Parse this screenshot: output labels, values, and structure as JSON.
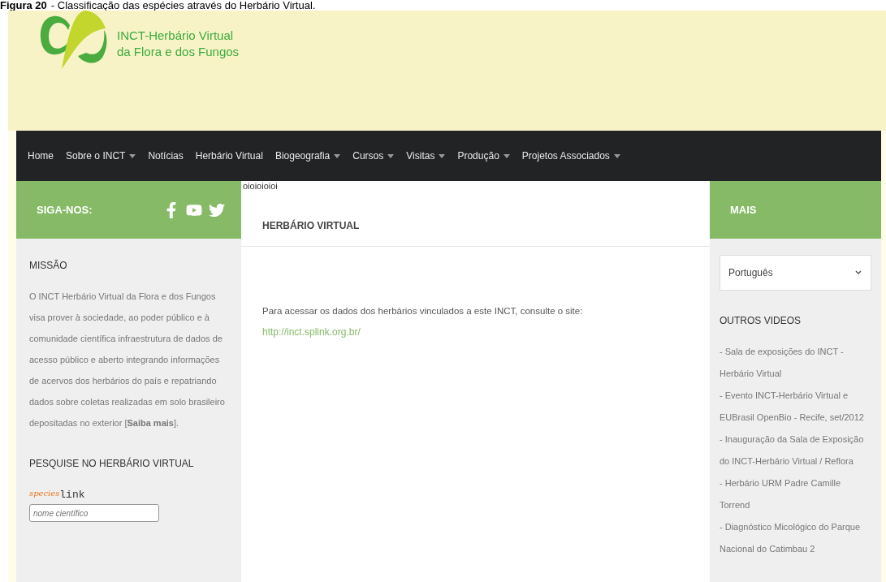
{
  "caption": {
    "label": "Figura 20",
    "text": "- Classificação das espécies através do Herbário Virtual."
  },
  "header": {
    "logo_line_1": "INCT-Herbário Virtual",
    "logo_line_2": "da Flora e dos Fungos"
  },
  "nav": [
    {
      "label": "Home",
      "dropdown": false
    },
    {
      "label": "Sobre o INCT",
      "dropdown": true
    },
    {
      "label": "Notícias",
      "dropdown": false
    },
    {
      "label": "Herbário Virtual",
      "dropdown": false
    },
    {
      "label": "Biogeografia",
      "dropdown": true
    },
    {
      "label": "Cursos",
      "dropdown": true
    },
    {
      "label": "Visitas",
      "dropdown": true
    },
    {
      "label": "Produção",
      "dropdown": true
    },
    {
      "label": "Projetos Associados",
      "dropdown": true
    }
  ],
  "left_sidebar": {
    "follow_title": "SIGA-NOS:",
    "social": [
      {
        "kind": "facebook"
      },
      {
        "kind": "youtube"
      },
      {
        "kind": "twitter"
      }
    ],
    "mission_title": "MISSÃO",
    "mission_text": "O INCT Herbário Virtual da Flora e dos Fungos visa prover à sociedade, ao poder público e à comunidade científica infraestrutura de dados de acesso público e aberto integrando informações de acervos dos herbários do país e repatriando dados sobre coletas realizadas em solo brasileiro depositadas no exterior [**Saiba mais**].",
    "search_title": "PESQUISE NO HERBÁRIO VIRTUAL",
    "species_logo": {
      "part_1": "species",
      "part_2": "link"
    },
    "search": {
      "placeholder": "nome científico"
    }
  },
  "main": {
    "tag": "oioioioioi",
    "title": "HERBÁRIO VIRTUAL",
    "text": "Para acessar os dados dos herbários vinculados a este INCT, consulte o site:",
    "link": "http://inct.splink.org.br/"
  },
  "right_sidebar": {
    "title": "MAIS",
    "language": {
      "value": "Português"
    },
    "videos_title": "OUTROS VIDEOS",
    "videos": [
      "- Sala de exposições do INCT - Herbário Virtual",
      "- Evento INCT-Herbário Virtual e EUBrasil OpenBio - Recife, set/2012",
      "- Inauguração da Sala de Exposição do INCT-Herbário Virtual / Reflora",
      "- Herbário URM Padre Camille Torrend",
      "- Diagnóstico Micológico do Parque Nacional do Catimbau 2"
    ]
  }
}
